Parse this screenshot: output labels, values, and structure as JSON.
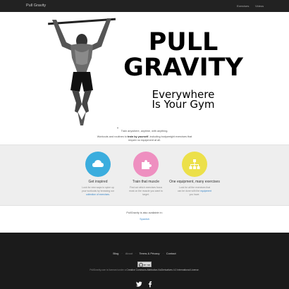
{
  "nav": {
    "brand": "Pull Gravity",
    "links": [
      "Exercises",
      "Videos"
    ]
  },
  "hero": {
    "title_line1": "PULL",
    "title_line2": "GRAVITY",
    "tagline_line1": "Everywhere",
    "tagline_line2": "Is Your Gym"
  },
  "intro": {
    "line1": "Train anywhere, anytime, with anything.",
    "line2_before": "Workouts and routines to ",
    "line2_bold": "train by yourself",
    "line2_after": ", including bodyweight exercises that",
    "line3": "require no equipment at all."
  },
  "features": [
    {
      "icon": "cloud-icon",
      "color": "#3badde",
      "title": "Get inspired",
      "desc_line1": "Look for new ways to spice up",
      "desc_line2": "your workouts by browsing our",
      "desc_link": "collection of exercises",
      "desc_tail": "."
    },
    {
      "icon": "puzzle-icon",
      "color": "#ee8fc0",
      "title": "Train that muscle",
      "desc_line1": "Find out which exercises focus",
      "desc_line2": "most on the muscle you want to",
      "desc_line3": "target."
    },
    {
      "icon": "sitemap-icon",
      "color": "#ece04a",
      "title": "One equipment, many exercises",
      "desc_line1": "Look for all the exercises that",
      "desc_line2_before": "can be done with the ",
      "desc_link": "equipment",
      "desc_line3": "you have."
    }
  ],
  "availability": {
    "text": "PullGravity is also available in:",
    "language": "Spanish"
  },
  "footer": {
    "links": [
      "Blog",
      "About",
      "Terms & Privacy",
      "Contact"
    ],
    "license_before": "PullGravity.com is licensed under a ",
    "license_bold": "Creative Commons Attribution-NoDerivatives 4.0 International License",
    "license_after": ".",
    "cc_label": "cc",
    "cc_marks": "BY ND",
    "social": [
      "twitter-icon",
      "facebook-icon"
    ]
  }
}
